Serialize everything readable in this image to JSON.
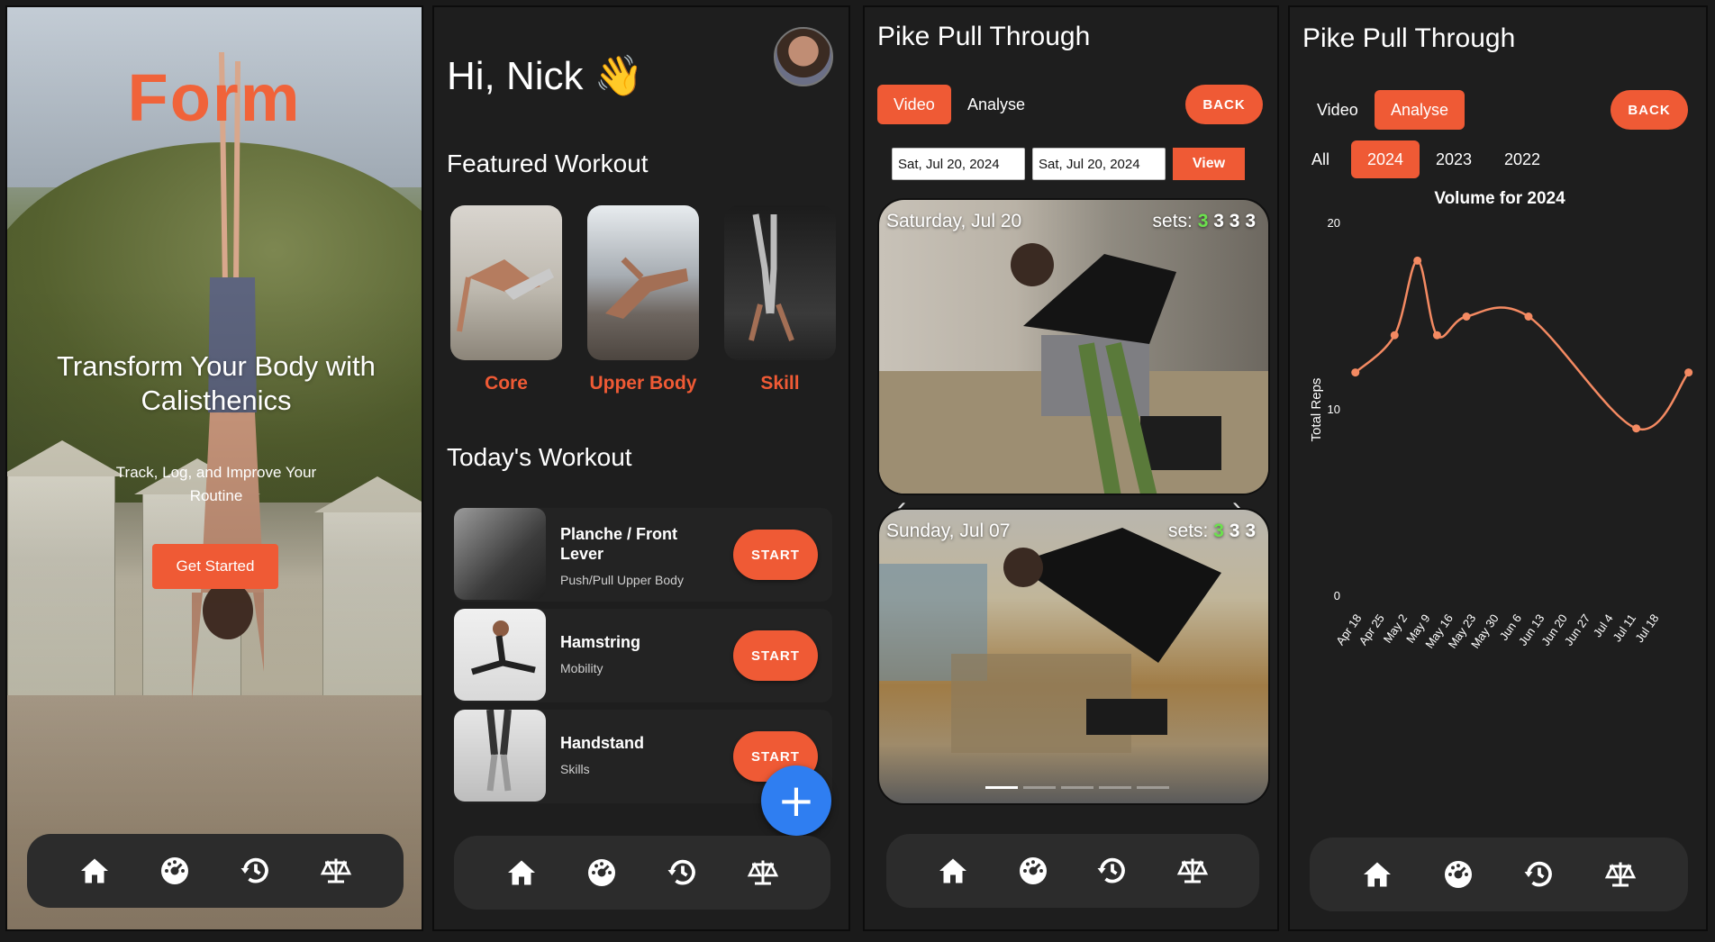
{
  "screen1": {
    "brand": "Form",
    "hero_title": "Transform Your Body with Calisthenics",
    "hero_subtitle": "Track, Log, and Improve Your Routine",
    "cta_label": "Get Started"
  },
  "screen2": {
    "greeting": "Hi, Nick 👋",
    "featured_heading": "Featured Workout",
    "featured": [
      {
        "label": "Core"
      },
      {
        "label": "Upper Body"
      },
      {
        "label": "Skill"
      }
    ],
    "today_heading": "Today's Workout",
    "workouts": [
      {
        "title": "Planche / Front Lever",
        "subtitle": "Push/Pull Upper Body",
        "action": "START"
      },
      {
        "title": "Hamstring",
        "subtitle": "Mobility",
        "action": "START"
      },
      {
        "title": "Handstand",
        "subtitle": "Skills",
        "action": "START"
      }
    ],
    "fab_label": "+"
  },
  "screen3": {
    "title": "Pike Pull Through",
    "tabs": [
      "Video",
      "Analyse"
    ],
    "active_tab": "Video",
    "back_label": "BACK",
    "date_from": "Sat, Jul 20, 2024",
    "date_to": "Sat, Jul 20, 2024",
    "view_label": "View",
    "cards": [
      {
        "day": "Saturday, Jul 20",
        "sets_label": "sets:",
        "sets": [
          "3",
          "3",
          "3",
          "3"
        ]
      },
      {
        "day": "Sunday, Jul 07",
        "sets_label": "sets:",
        "sets": [
          "3",
          "3",
          "3"
        ]
      }
    ]
  },
  "screen4": {
    "title": "Pike Pull Through",
    "tabs": [
      "Video",
      "Analyse"
    ],
    "active_tab": "Analyse",
    "back_label": "BACK",
    "years": [
      "All",
      "2024",
      "2023",
      "2022"
    ],
    "active_year": "2024"
  },
  "chart_data": {
    "type": "line",
    "title": "Volume for 2024",
    "ylabel": "Total Reps",
    "xlabel": "",
    "ylim": [
      0,
      20
    ],
    "yticks": [
      0,
      10,
      20
    ],
    "x": [
      "Apr 18",
      "Apr 25",
      "May 2",
      "May 9",
      "May 16",
      "May 23",
      "May 30",
      "Jun 6",
      "Jun 13",
      "Jun 20",
      "Jun 27",
      "Jul 4",
      "Jul 11",
      "Jul 18"
    ],
    "points": [
      {
        "x": "Apr 16",
        "y": 12
      },
      {
        "x": "Apr 28",
        "y": 14
      },
      {
        "x": "May 5",
        "y": 18
      },
      {
        "x": "May 11",
        "y": 14
      },
      {
        "x": "May 20",
        "y": 15
      },
      {
        "x": "Jun 8",
        "y": 15
      },
      {
        "x": "Jul 11",
        "y": 9
      },
      {
        "x": "Jul 27",
        "y": 12
      }
    ],
    "color": "#f48a62"
  },
  "nav": [
    "home-icon",
    "dashboard-icon",
    "history-icon",
    "balance-icon"
  ],
  "colors": {
    "accent": "#ef5a35",
    "fab": "#2f7ef1",
    "background": "#1e1e1e",
    "navbar": "#2c2c2c"
  }
}
